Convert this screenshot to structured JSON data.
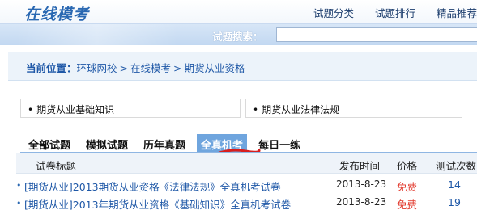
{
  "header": {
    "logo": "在线模考",
    "nav": [
      "试题分类",
      "试题排行",
      "精品推荐"
    ]
  },
  "search": {
    "label": "试题搜索：",
    "value": ""
  },
  "breadcrumb": {
    "lead": "当前位置：",
    "items": [
      "环球网校",
      "在线模考",
      "期货从业资格"
    ],
    "separator": ">"
  },
  "categories": [
    "期货从业基础知识",
    "期货从业法律法规"
  ],
  "category_bullet": "•",
  "tabs": [
    "全部试题",
    "模拟试题",
    "历年真题",
    "全真机考",
    "每日一练"
  ],
  "active_tab": "全真机考",
  "table": {
    "headers": {
      "title": "试卷标题",
      "time": "发布时间",
      "price": "价格",
      "count": "测试次数"
    },
    "rows": [
      {
        "title": "[期货从业]2013期货从业资格《法律法规》全真机考试卷",
        "time": "2013-8-23",
        "price": "免费",
        "count": "14"
      },
      {
        "title": "[期货从业]2013年期货从业资格《基础知识》全真机考试卷",
        "time": "2013-8-23",
        "price": "免费",
        "count": "19"
      }
    ]
  },
  "colors": {
    "brand_blue": "#2a68b2",
    "link_blue": "#1f58a7",
    "active_tab_bg": "#6fa5de",
    "price_red": "#e23a2e",
    "annotation_red": "#d81e1e"
  }
}
